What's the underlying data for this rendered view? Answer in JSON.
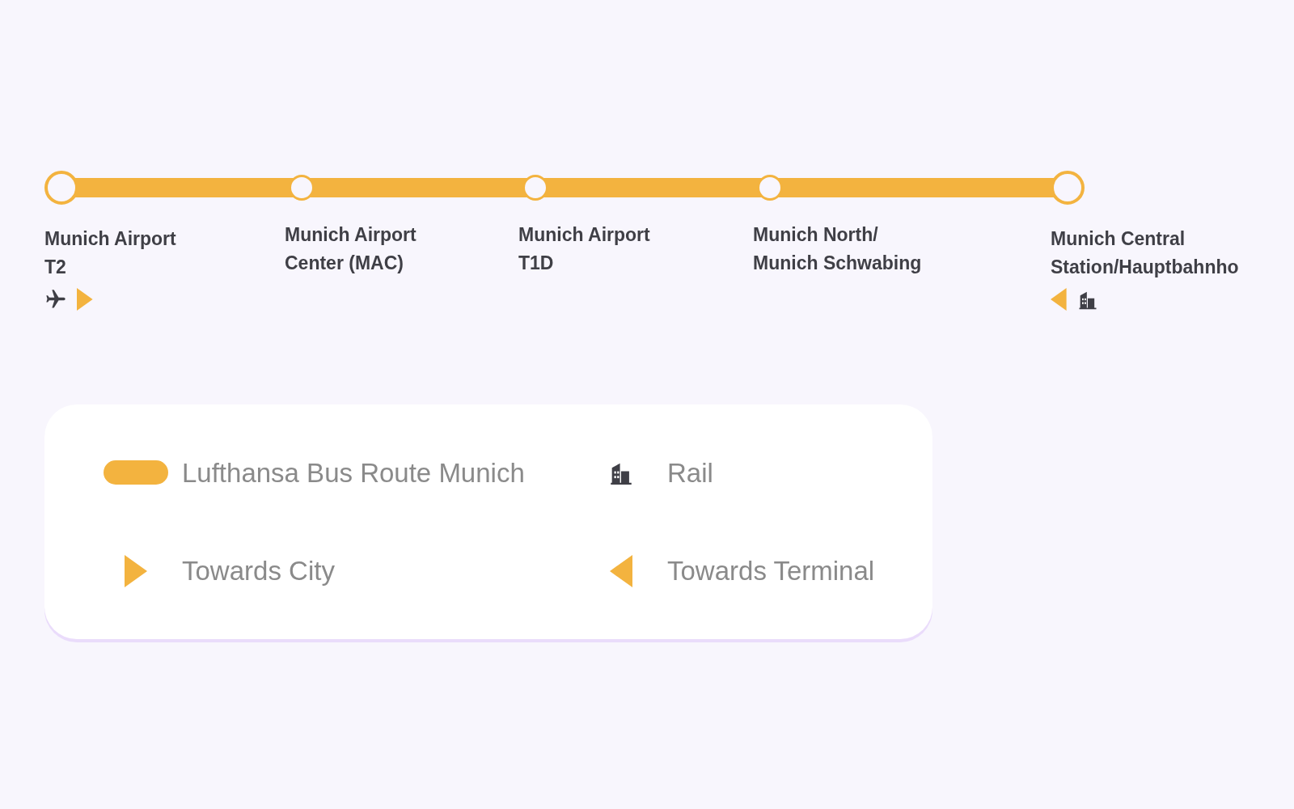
{
  "route": {
    "stations": [
      {
        "name": "Munich Airport T2",
        "kind": "terminal",
        "icons": [
          {
            "kind": "plane"
          },
          {
            "kind": "towards_city"
          }
        ]
      },
      {
        "name": "Munich Airport Center (MAC)",
        "kind": "stop"
      },
      {
        "name": "Munich Airport T1D",
        "kind": "stop"
      },
      {
        "name": "Munich North/ Munich Schwabing",
        "kind": "stop"
      },
      {
        "name": "Munich Central Station/Hauptbahnho",
        "kind": "terminal",
        "icons": [
          {
            "kind": "towards_terminal"
          },
          {
            "kind": "rail"
          }
        ]
      }
    ]
  },
  "legend": [
    {
      "kind": "route",
      "label": "Lufthansa Bus Route Munich"
    },
    {
      "kind": "rail",
      "label": "Rail"
    },
    {
      "kind": "towards_city",
      "label": "Towards City"
    },
    {
      "kind": "towards_terminal",
      "label": "Towards Terminal"
    }
  ]
}
